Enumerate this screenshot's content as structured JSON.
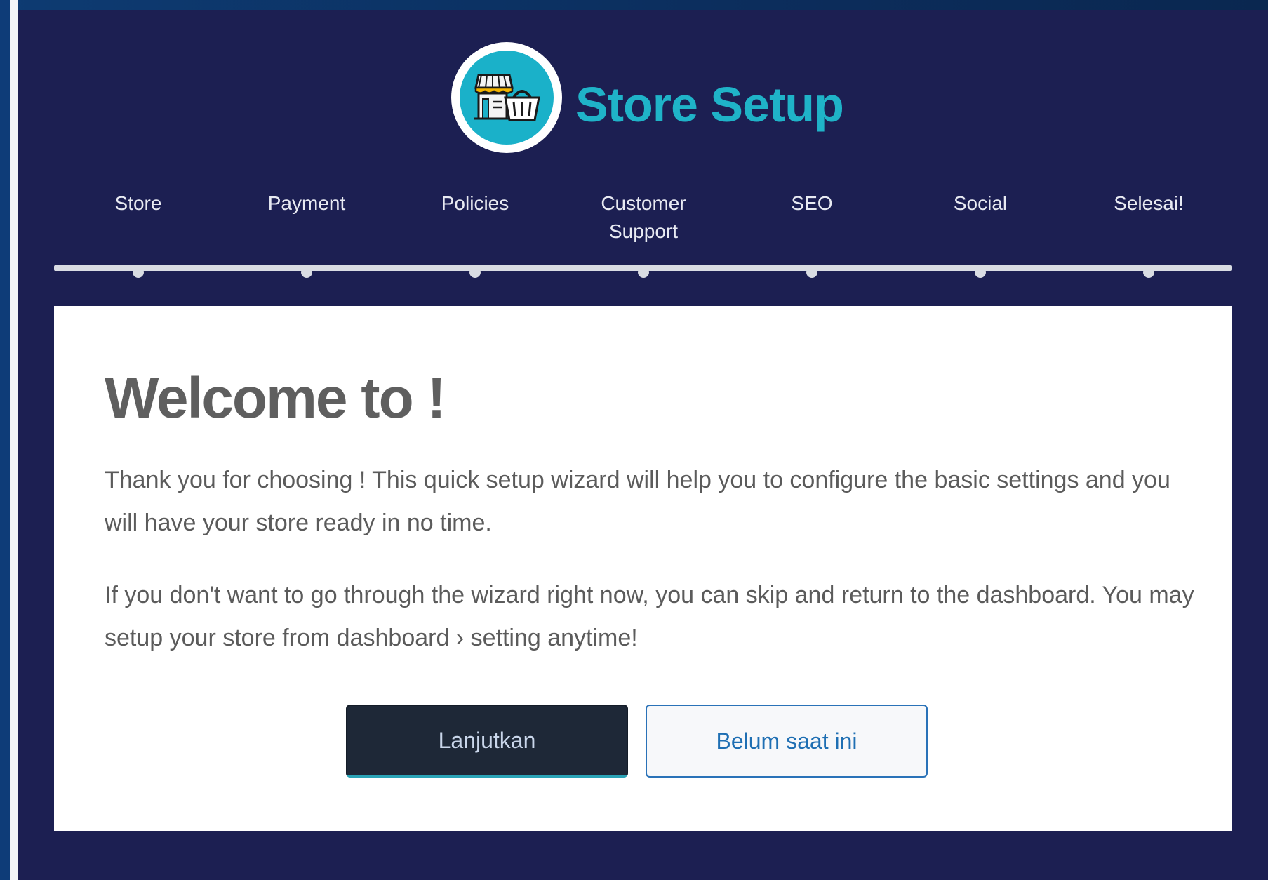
{
  "header": {
    "title": "Store Setup",
    "logo_icon": "storefront-basket-icon"
  },
  "steps": [
    {
      "label": "Store"
    },
    {
      "label": "Payment"
    },
    {
      "label": "Policies"
    },
    {
      "label": "Customer Support"
    },
    {
      "label": "SEO"
    },
    {
      "label": "Social"
    },
    {
      "label": "Selesai!"
    }
  ],
  "content": {
    "heading": "Welcome to !",
    "paragraph_1": "Thank you for choosing ! This quick setup wizard will help you to configure the basic settings and you will have your store ready in no time.",
    "paragraph_2": "If you don't want to go through the wizard right now, you can skip and return to the dashboard. You may setup your store from dashboard › setting anytime!"
  },
  "actions": {
    "continue_label": "Lanjutkan",
    "skip_label": "Belum saat ini"
  },
  "colors": {
    "background": "#1c1f52",
    "accent": "#1fb3c8",
    "card": "#ffffff",
    "primary_button": "#1e2837",
    "link_blue": "#1f6fb3"
  }
}
